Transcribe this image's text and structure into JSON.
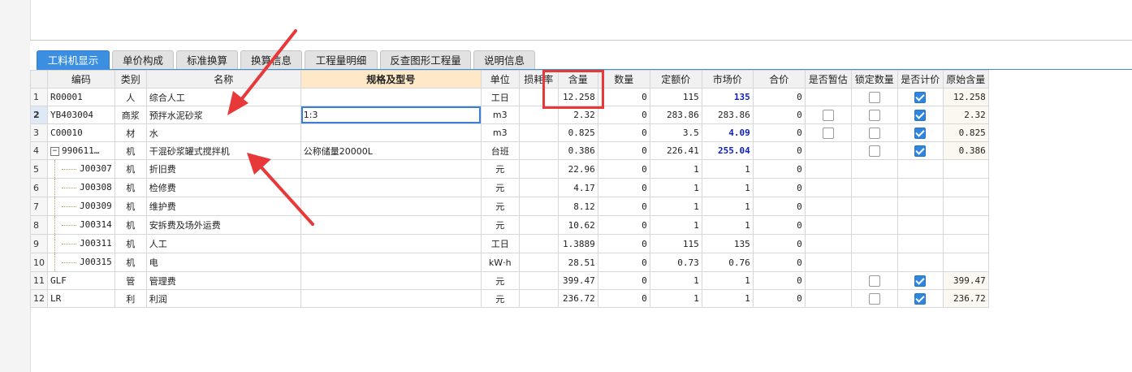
{
  "tabs": [
    {
      "label": "工料机显示",
      "active": true
    },
    {
      "label": "单价构成",
      "active": false
    },
    {
      "label": "标准换算",
      "active": false
    },
    {
      "label": "换算信息",
      "active": false
    },
    {
      "label": "工程量明细",
      "active": false
    },
    {
      "label": "反查图形工程量",
      "active": false
    },
    {
      "label": "说明信息",
      "active": false
    }
  ],
  "columns": [
    "编码",
    "类别",
    "名称",
    "规格及型号",
    "单位",
    "损耗率",
    "含量",
    "数量",
    "定额价",
    "市场价",
    "合价",
    "是否暂估",
    "锁定数量",
    "是否计价",
    "原始含量"
  ],
  "rows": [
    {
      "no": "1",
      "code": "R00001",
      "type": "人",
      "name": "综合人工",
      "spec": "",
      "unit": "工日",
      "loss": "",
      "qty": "12.258",
      "count": "0",
      "quota": "115",
      "market": "135",
      "total": "0",
      "est": null,
      "lock": false,
      "priced": true,
      "orig": "12.258",
      "market_bold": true
    },
    {
      "no": "2",
      "code": "YB403004",
      "type": "商浆",
      "name": "预拌水泥砂浆",
      "spec": "1:3",
      "unit": "m3",
      "loss": "",
      "qty": "2.32",
      "count": "0",
      "quota": "283.86",
      "market": "283.86",
      "total": "0",
      "est": false,
      "lock": false,
      "priced": true,
      "orig": "2.32",
      "market_bold": false
    },
    {
      "no": "3",
      "code": "C00010",
      "type": "材",
      "name": "水",
      "spec": "",
      "unit": "m3",
      "loss": "",
      "qty": "0.825",
      "count": "0",
      "quota": "3.5",
      "market": "4.09",
      "total": "0",
      "est": false,
      "lock": false,
      "priced": true,
      "orig": "0.825",
      "market_bold": true
    },
    {
      "no": "4",
      "code": "990611…",
      "type": "机",
      "name": "干混砂浆罐式搅拌机",
      "spec": "公称储量20000L",
      "unit": "台班",
      "loss": "",
      "qty": "0.386",
      "count": "0",
      "quota": "226.41",
      "market": "255.04",
      "total": "0",
      "est": null,
      "lock": false,
      "priced": true,
      "orig": "0.386",
      "market_bold": true
    },
    {
      "no": "5",
      "code": "J00307",
      "type": "机",
      "name": "折旧费",
      "spec": "",
      "unit": "元",
      "loss": "",
      "qty": "22.96",
      "count": "0",
      "quota": "1",
      "market": "1",
      "total": "0",
      "est": null,
      "lock": null,
      "priced": null,
      "orig": "",
      "market_bold": false
    },
    {
      "no": "6",
      "code": "J00308",
      "type": "机",
      "name": "检修费",
      "spec": "",
      "unit": "元",
      "loss": "",
      "qty": "4.17",
      "count": "0",
      "quota": "1",
      "market": "1",
      "total": "0",
      "est": null,
      "lock": null,
      "priced": null,
      "orig": "",
      "market_bold": false
    },
    {
      "no": "7",
      "code": "J00309",
      "type": "机",
      "name": "维护费",
      "spec": "",
      "unit": "元",
      "loss": "",
      "qty": "8.12",
      "count": "0",
      "quota": "1",
      "market": "1",
      "total": "0",
      "est": null,
      "lock": null,
      "priced": null,
      "orig": "",
      "market_bold": false
    },
    {
      "no": "8",
      "code": "J00314",
      "type": "机",
      "name": "安拆费及场外运费",
      "spec": "",
      "unit": "元",
      "loss": "",
      "qty": "10.62",
      "count": "0",
      "quota": "1",
      "market": "1",
      "total": "0",
      "est": null,
      "lock": null,
      "priced": null,
      "orig": "",
      "market_bold": false
    },
    {
      "no": "9",
      "code": "J00311",
      "type": "机",
      "name": "人工",
      "spec": "",
      "unit": "工日",
      "loss": "",
      "qty": "1.3889",
      "count": "0",
      "quota": "115",
      "market": "135",
      "total": "0",
      "est": null,
      "lock": null,
      "priced": null,
      "orig": "",
      "market_bold": false
    },
    {
      "no": "10",
      "code": "J00315",
      "type": "机",
      "name": "电",
      "spec": "",
      "unit": "kW·h",
      "loss": "",
      "qty": "28.51",
      "count": "0",
      "quota": "0.73",
      "market": "0.76",
      "total": "0",
      "est": null,
      "lock": null,
      "priced": null,
      "orig": "",
      "market_bold": false
    },
    {
      "no": "11",
      "code": "GLF",
      "type": "管",
      "name": "管理费",
      "spec": "",
      "unit": "元",
      "loss": "",
      "qty": "399.47",
      "count": "0",
      "quota": "1",
      "market": "1",
      "total": "0",
      "est": null,
      "lock": false,
      "priced": true,
      "orig": "399.47",
      "market_bold": false
    },
    {
      "no": "12",
      "code": "LR",
      "type": "利",
      "name": "利润",
      "spec": "",
      "unit": "元",
      "loss": "",
      "qty": "236.72",
      "count": "0",
      "quota": "1",
      "market": "1",
      "total": "0",
      "est": null,
      "lock": false,
      "priced": true,
      "orig": "236.72",
      "market_bold": false
    }
  ],
  "colors": {
    "accent": "#3b8ee0",
    "annotation": "#e8393a",
    "bold_price": "#1020c0"
  }
}
